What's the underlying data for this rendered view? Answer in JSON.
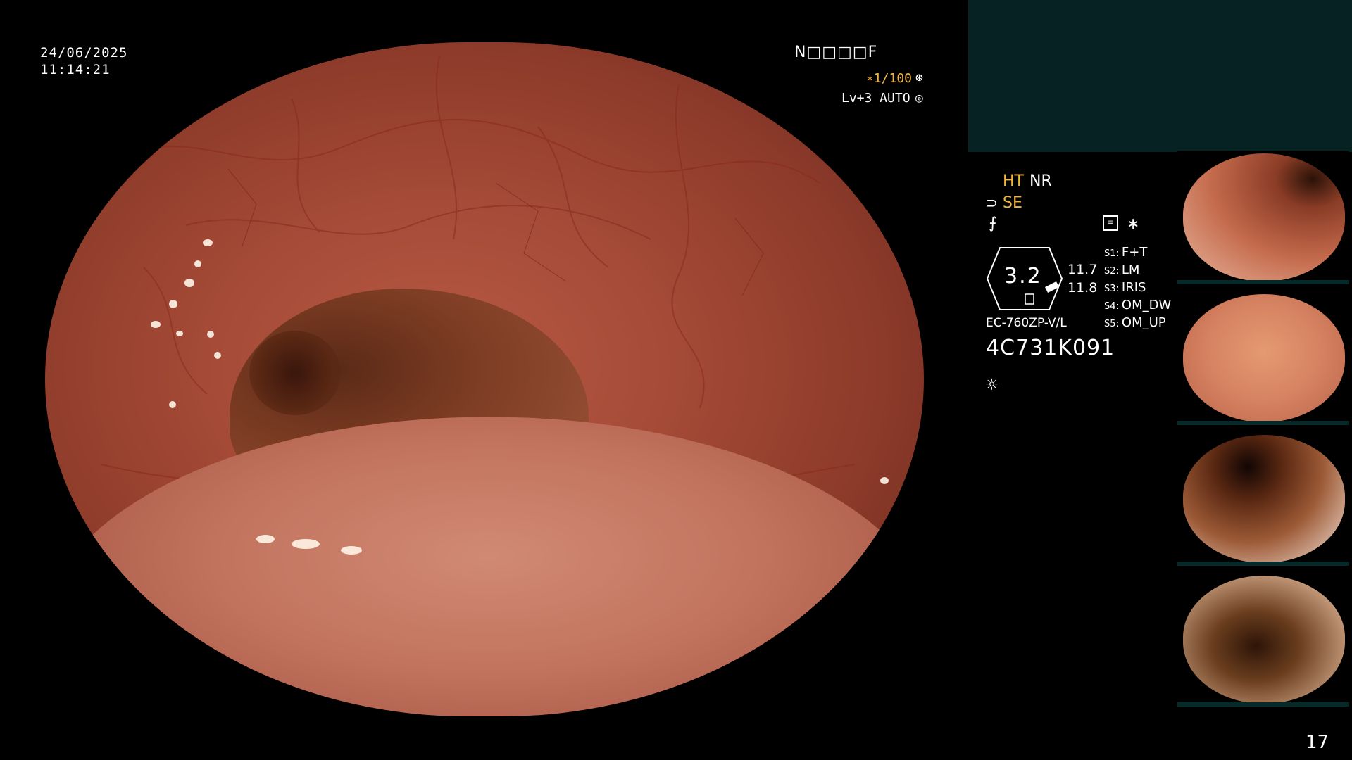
{
  "datetime": {
    "date": "24/06/2025",
    "time": "11:14:21"
  },
  "overlay": {
    "code": "N□□□□F",
    "shutter": "∗1/100",
    "shutter_icon": "⊛",
    "level": "Lv+3 AUTO",
    "auto_icon": "◎"
  },
  "panel": {
    "ht": "HT",
    "nr": "NR",
    "se_icon": "⊃",
    "se": "SE",
    "fx_icon": "⨍",
    "memo_icon": "≡",
    "star": "∗",
    "gauge_value": "3.2",
    "num1": "11.7",
    "num2": "11.8",
    "scope_model": "EC-760ZP-V/L",
    "serial": "4C731K091",
    "light_icon": "☼",
    "switches": [
      {
        "key": "S1:",
        "val": "F+T"
      },
      {
        "key": "S2:",
        "val": "LM"
      },
      {
        "key": "S3:",
        "val": "IRIS"
      },
      {
        "key": "S4:",
        "val": "OM_DW"
      },
      {
        "key": "S5:",
        "val": "OM_UP"
      }
    ]
  },
  "page_number": "17"
}
